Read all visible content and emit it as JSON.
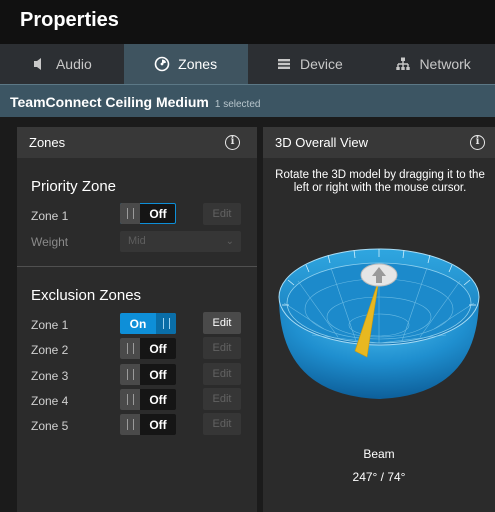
{
  "window": {
    "title": "Properties"
  },
  "tabs": [
    {
      "label": "Audio",
      "icon": "speaker-icon",
      "active": false
    },
    {
      "label": "Zones",
      "icon": "zones-icon",
      "active": true
    },
    {
      "label": "Device",
      "icon": "device-list-icon",
      "active": false
    },
    {
      "label": "Network",
      "icon": "network-icon",
      "active": false
    }
  ],
  "device": {
    "name": "TeamConnect Ceiling Medium",
    "selection": "1 selected"
  },
  "zones_panel": {
    "title": "Zones",
    "info_icon": "i",
    "priority": {
      "title": "Priority Zone",
      "zone_label": "Zone 1",
      "toggle_label": "Off",
      "edit_label": "Edit",
      "weight_label": "Weight",
      "weight_value": "Mid"
    },
    "exclusion": {
      "title": "Exclusion Zones",
      "zones": [
        {
          "label": "Zone 1",
          "state": "On",
          "edit": "Edit"
        },
        {
          "label": "Zone 2",
          "state": "Off",
          "edit": "Edit"
        },
        {
          "label": "Zone 3",
          "state": "Off",
          "edit": "Edit"
        },
        {
          "label": "Zone 4",
          "state": "Off",
          "edit": "Edit"
        },
        {
          "label": "Zone 5",
          "state": "Off",
          "edit": "Edit"
        }
      ]
    }
  },
  "overview_panel": {
    "title": "3D Overall View",
    "info_icon": "i",
    "hint": "Rotate the 3D model by dragging it to the left or right with the mouse cursor.",
    "beam_label": "Beam",
    "beam_value": "247° / 74°"
  },
  "colors": {
    "accent": "#0e8fd8",
    "device_bar": "#3c5563",
    "active_tab": "#3f5460",
    "dome": "#2a9ad6",
    "beam": "#e8b820"
  }
}
